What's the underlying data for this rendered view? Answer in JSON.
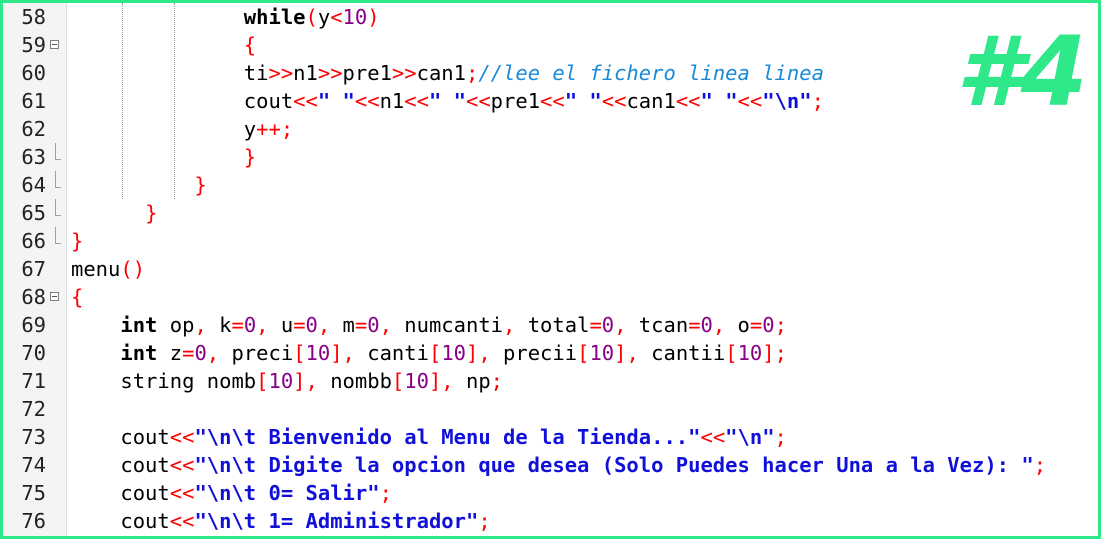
{
  "editor": {
    "badge": "#4",
    "lines": [
      {
        "no": "58",
        "fold": "none",
        "indent": "              ",
        "tokens": [
          {
            "t": "kw",
            "v": "while"
          },
          {
            "t": "op",
            "v": "("
          },
          {
            "t": "tok",
            "v": "y"
          },
          {
            "t": "op",
            "v": "<"
          },
          {
            "t": "num",
            "v": "10"
          },
          {
            "t": "op",
            "v": ")"
          }
        ]
      },
      {
        "no": "59",
        "fold": "start",
        "indent": "              ",
        "tokens": [
          {
            "t": "op",
            "v": "{"
          }
        ]
      },
      {
        "no": "60",
        "fold": "none",
        "indent": "              ",
        "tokens": [
          {
            "t": "tok",
            "v": "ti"
          },
          {
            "t": "op",
            "v": ">>"
          },
          {
            "t": "tok",
            "v": "n1"
          },
          {
            "t": "op",
            "v": ">>"
          },
          {
            "t": "tok",
            "v": "pre1"
          },
          {
            "t": "op",
            "v": ">>"
          },
          {
            "t": "tok",
            "v": "can1"
          },
          {
            "t": "op",
            "v": ";"
          },
          {
            "t": "cmt",
            "v": "//lee el fichero linea linea"
          }
        ]
      },
      {
        "no": "61",
        "fold": "none",
        "indent": "              ",
        "tokens": [
          {
            "t": "tok",
            "v": "cout"
          },
          {
            "t": "op",
            "v": "<<"
          },
          {
            "t": "str",
            "v": "\" \""
          },
          {
            "t": "op",
            "v": "<<"
          },
          {
            "t": "tok",
            "v": "n1"
          },
          {
            "t": "op",
            "v": "<<"
          },
          {
            "t": "str",
            "v": "\" \""
          },
          {
            "t": "op",
            "v": "<<"
          },
          {
            "t": "tok",
            "v": "pre1"
          },
          {
            "t": "op",
            "v": "<<"
          },
          {
            "t": "str",
            "v": "\" \""
          },
          {
            "t": "op",
            "v": "<<"
          },
          {
            "t": "tok",
            "v": "can1"
          },
          {
            "t": "op",
            "v": "<<"
          },
          {
            "t": "str",
            "v": "\" \""
          },
          {
            "t": "op",
            "v": "<<"
          },
          {
            "t": "str",
            "v": "\""
          },
          {
            "t": "esc",
            "v": "\\n"
          },
          {
            "t": "str",
            "v": "\""
          },
          {
            "t": "op",
            "v": ";"
          }
        ]
      },
      {
        "no": "62",
        "fold": "none",
        "indent": "              ",
        "tokens": [
          {
            "t": "tok",
            "v": "y"
          },
          {
            "t": "op",
            "v": "++;"
          }
        ]
      },
      {
        "no": "63",
        "fold": "end",
        "indent": "              ",
        "tokens": [
          {
            "t": "op",
            "v": "}"
          }
        ]
      },
      {
        "no": "64",
        "fold": "end",
        "indent": "          ",
        "tokens": [
          {
            "t": "op",
            "v": "}"
          }
        ]
      },
      {
        "no": "65",
        "fold": "end",
        "indent": "      ",
        "tokens": [
          {
            "t": "op",
            "v": "}"
          }
        ]
      },
      {
        "no": "66",
        "fold": "end",
        "indent": "",
        "tokens": [
          {
            "t": "op",
            "v": "}"
          }
        ]
      },
      {
        "no": "67",
        "fold": "none",
        "indent": "",
        "tokens": [
          {
            "t": "tok",
            "v": "menu"
          },
          {
            "t": "op",
            "v": "()"
          }
        ]
      },
      {
        "no": "68",
        "fold": "start",
        "indent": "",
        "tokens": [
          {
            "t": "op",
            "v": "{"
          }
        ]
      },
      {
        "no": "69",
        "fold": "none",
        "indent": "    ",
        "tokens": [
          {
            "t": "kw",
            "v": "int"
          },
          {
            "t": "tok",
            "v": " op"
          },
          {
            "t": "op",
            "v": ","
          },
          {
            "t": "tok",
            "v": " k"
          },
          {
            "t": "op",
            "v": "="
          },
          {
            "t": "num",
            "v": "0"
          },
          {
            "t": "op",
            "v": ","
          },
          {
            "t": "tok",
            "v": " u"
          },
          {
            "t": "op",
            "v": "="
          },
          {
            "t": "num",
            "v": "0"
          },
          {
            "t": "op",
            "v": ","
          },
          {
            "t": "tok",
            "v": " m"
          },
          {
            "t": "op",
            "v": "="
          },
          {
            "t": "num",
            "v": "0"
          },
          {
            "t": "op",
            "v": ","
          },
          {
            "t": "tok",
            "v": " numcanti"
          },
          {
            "t": "op",
            "v": ","
          },
          {
            "t": "tok",
            "v": " total"
          },
          {
            "t": "op",
            "v": "="
          },
          {
            "t": "num",
            "v": "0"
          },
          {
            "t": "op",
            "v": ","
          },
          {
            "t": "tok",
            "v": " tcan"
          },
          {
            "t": "op",
            "v": "="
          },
          {
            "t": "num",
            "v": "0"
          },
          {
            "t": "op",
            "v": ","
          },
          {
            "t": "tok",
            "v": " o"
          },
          {
            "t": "op",
            "v": "="
          },
          {
            "t": "num",
            "v": "0"
          },
          {
            "t": "op",
            "v": ";"
          }
        ]
      },
      {
        "no": "70",
        "fold": "none",
        "indent": "    ",
        "tokens": [
          {
            "t": "kw",
            "v": "int"
          },
          {
            "t": "tok",
            "v": " z"
          },
          {
            "t": "op",
            "v": "="
          },
          {
            "t": "num",
            "v": "0"
          },
          {
            "t": "op",
            "v": ","
          },
          {
            "t": "tok",
            "v": " preci"
          },
          {
            "t": "op",
            "v": "["
          },
          {
            "t": "num",
            "v": "10"
          },
          {
            "t": "op",
            "v": "],"
          },
          {
            "t": "tok",
            "v": " canti"
          },
          {
            "t": "op",
            "v": "["
          },
          {
            "t": "num",
            "v": "10"
          },
          {
            "t": "op",
            "v": "],"
          },
          {
            "t": "tok",
            "v": " precii"
          },
          {
            "t": "op",
            "v": "["
          },
          {
            "t": "num",
            "v": "10"
          },
          {
            "t": "op",
            "v": "],"
          },
          {
            "t": "tok",
            "v": " cantii"
          },
          {
            "t": "op",
            "v": "["
          },
          {
            "t": "num",
            "v": "10"
          },
          {
            "t": "op",
            "v": "];"
          }
        ]
      },
      {
        "no": "71",
        "fold": "none",
        "indent": "    ",
        "tokens": [
          {
            "t": "tok",
            "v": "string nomb"
          },
          {
            "t": "op",
            "v": "["
          },
          {
            "t": "num",
            "v": "10"
          },
          {
            "t": "op",
            "v": "],"
          },
          {
            "t": "tok",
            "v": " nombb"
          },
          {
            "t": "op",
            "v": "["
          },
          {
            "t": "num",
            "v": "10"
          },
          {
            "t": "op",
            "v": "],"
          },
          {
            "t": "tok",
            "v": " np"
          },
          {
            "t": "op",
            "v": ";"
          }
        ]
      },
      {
        "no": "72",
        "fold": "none",
        "indent": "",
        "tokens": []
      },
      {
        "no": "73",
        "fold": "none",
        "indent": "    ",
        "tokens": [
          {
            "t": "tok",
            "v": "cout"
          },
          {
            "t": "op",
            "v": "<<"
          },
          {
            "t": "str",
            "v": "\""
          },
          {
            "t": "esc",
            "v": "\\n\\t"
          },
          {
            "t": "str",
            "v": " Bienvenido al Menu de la Tienda...\""
          },
          {
            "t": "op",
            "v": "<<"
          },
          {
            "t": "str",
            "v": "\""
          },
          {
            "t": "esc",
            "v": "\\n"
          },
          {
            "t": "str",
            "v": "\""
          },
          {
            "t": "op",
            "v": ";"
          }
        ]
      },
      {
        "no": "74",
        "fold": "none",
        "indent": "    ",
        "tokens": [
          {
            "t": "tok",
            "v": "cout"
          },
          {
            "t": "op",
            "v": "<<"
          },
          {
            "t": "str",
            "v": "\""
          },
          {
            "t": "esc",
            "v": "\\n\\t"
          },
          {
            "t": "str",
            "v": " Digite la opcion que desea (Solo Puedes hacer Una a la Vez): \""
          },
          {
            "t": "op",
            "v": ";"
          }
        ]
      },
      {
        "no": "75",
        "fold": "none",
        "indent": "    ",
        "tokens": [
          {
            "t": "tok",
            "v": "cout"
          },
          {
            "t": "op",
            "v": "<<"
          },
          {
            "t": "str",
            "v": "\""
          },
          {
            "t": "esc",
            "v": "\\n\\t"
          },
          {
            "t": "str",
            "v": " 0= Salir\""
          },
          {
            "t": "op",
            "v": ";"
          }
        ]
      },
      {
        "no": "76",
        "fold": "none",
        "indent": "    ",
        "tokens": [
          {
            "t": "tok",
            "v": "cout"
          },
          {
            "t": "op",
            "v": "<<"
          },
          {
            "t": "str",
            "v": "\""
          },
          {
            "t": "esc",
            "v": "\\n\\t"
          },
          {
            "t": "str",
            "v": " 1= Administrador\""
          },
          {
            "t": "op",
            "v": ";"
          }
        ]
      }
    ]
  }
}
